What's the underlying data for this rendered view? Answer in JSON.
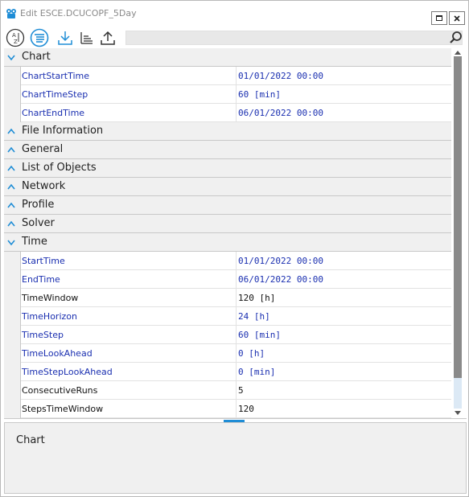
{
  "window": {
    "title": "Edit ESCE.DCUCOPF_5Day"
  },
  "toolbar": {
    "buttons": [
      {
        "icon": "sort-alphabetical-icon"
      },
      {
        "icon": "categorized-view-icon",
        "active": true
      },
      {
        "icon": "download-icon"
      },
      {
        "icon": "tree-list-icon"
      },
      {
        "icon": "upload-icon"
      }
    ],
    "search_placeholder": "",
    "accent_color": "#1f8dd6"
  },
  "grid": {
    "categories": [
      {
        "label": "Chart",
        "expanded": true,
        "properties": [
          {
            "name": "ChartStartTime",
            "value": "01/01/2022 00:00",
            "color": "blue"
          },
          {
            "name": "ChartTimeStep",
            "value": "60 [min]",
            "color": "blue"
          },
          {
            "name": "ChartEndTime",
            "value": "06/01/2022 00:00",
            "color": "blue"
          }
        ]
      },
      {
        "label": "File Information",
        "expanded": false,
        "properties": []
      },
      {
        "label": "General",
        "expanded": false,
        "properties": []
      },
      {
        "label": "List of Objects",
        "expanded": false,
        "properties": []
      },
      {
        "label": "Network",
        "expanded": false,
        "properties": []
      },
      {
        "label": "Profile",
        "expanded": false,
        "properties": []
      },
      {
        "label": "Solver",
        "expanded": false,
        "properties": []
      },
      {
        "label": "Time",
        "expanded": true,
        "properties": [
          {
            "name": "StartTime",
            "value": "01/01/2022 00:00",
            "color": "blue"
          },
          {
            "name": "EndTime",
            "value": "06/01/2022 00:00",
            "color": "blue"
          },
          {
            "name": "TimeWindow",
            "value": "120 [h]",
            "color": "black"
          },
          {
            "name": "TimeHorizon",
            "value": "24 [h]",
            "color": "blue"
          },
          {
            "name": "TimeStep",
            "value": "60 [min]",
            "color": "blue"
          },
          {
            "name": "TimeLookAhead",
            "value": "0 [h]",
            "color": "blue"
          },
          {
            "name": "TimeStepLookAhead",
            "value": "0 [min]",
            "color": "blue"
          },
          {
            "name": "ConsecutiveRuns",
            "value": "5",
            "color": "black"
          },
          {
            "name": "StepsTimeWindow",
            "value": "120",
            "color": "black"
          }
        ]
      }
    ]
  },
  "description": {
    "title": "Chart"
  }
}
